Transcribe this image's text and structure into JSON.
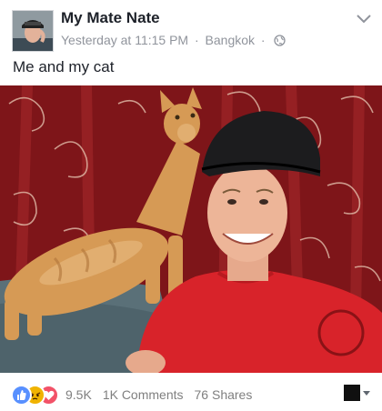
{
  "post": {
    "author": "My Mate Nate",
    "timestamp": "Yesterday at 11:15 PM",
    "separator": "·",
    "location": "Bangkok",
    "audience_icon": "globe-icon",
    "caption": "Me and my cat",
    "photo_subject": "selfie-with-cat"
  },
  "footer": {
    "reaction_icons": [
      "like-icon",
      "angry-icon",
      "love-icon"
    ],
    "reaction_count": "9.5K",
    "comments": "1K Comments",
    "shares": "76 Shares"
  },
  "colors": {
    "like": "#5890ff",
    "angry": "#f0b300",
    "love": "#f25268",
    "curtain": "#8c1a1e",
    "sofa": "#5a7078",
    "shirt": "#d8232a",
    "cat": "#d69a55"
  }
}
